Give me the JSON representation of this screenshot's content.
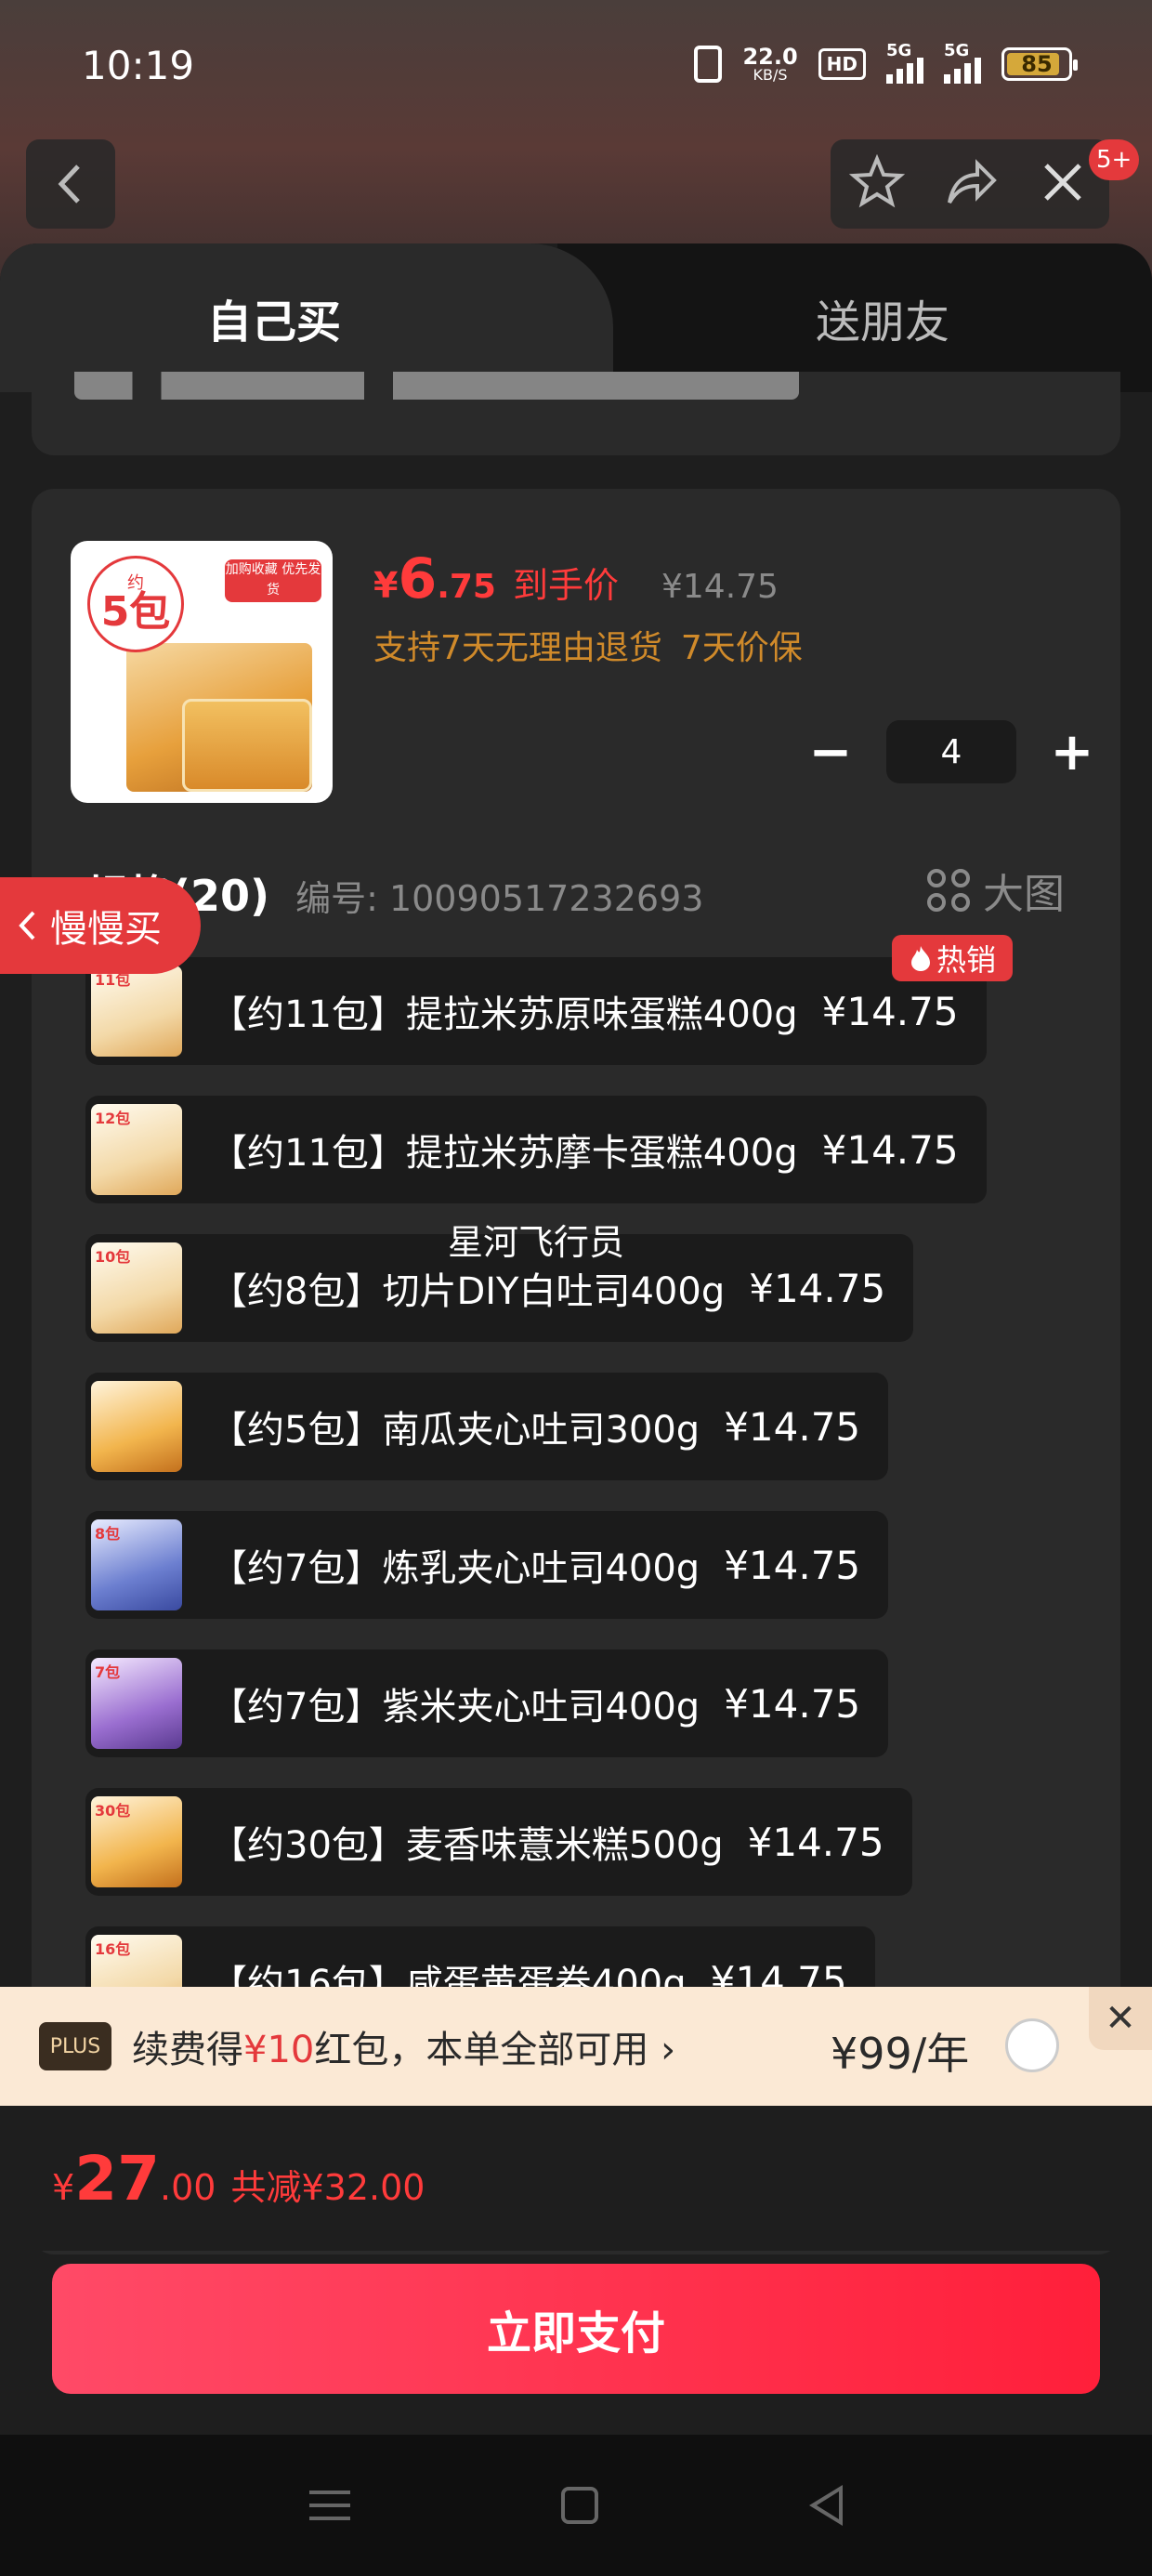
{
  "status_bar": {
    "time": "10:19",
    "net_speed": "22.0",
    "net_unit": "KB/S",
    "hd_label": "HD",
    "sim1_label": "5G",
    "sim2_label": "5G",
    "battery": "85"
  },
  "header": {
    "notification_badge": "5+"
  },
  "tabs": {
    "self": "自己买",
    "friend": "送朋友"
  },
  "product": {
    "image_circle_top": "约",
    "image_circle_main": "5包",
    "image_tag": "加购收藏 优先发货",
    "price_symbol": "¥",
    "price_int": "6",
    "price_dec": ".75",
    "price_label": "到手价",
    "original_price": "¥14.75",
    "guarantee_1": "支持7天无理由退货",
    "guarantee_2": "7天价保",
    "quantity": "4",
    "minus_symbol": "−",
    "plus_symbol": "+"
  },
  "spec": {
    "title": "规格(20)",
    "code_label": "编号: 10090517232693",
    "big_image": "大图",
    "hot_tag": "热销",
    "watermark": "星河飞行员",
    "items": [
      {
        "thumb_num": "11包",
        "label": "【约11包】提拉米苏原味蛋糕400g",
        "price": "¥14.75",
        "color": "white"
      },
      {
        "thumb_num": "12包",
        "label": "【约11包】提拉米苏摩卡蛋糕400g",
        "price": "¥14.75",
        "color": "white"
      },
      {
        "thumb_num": "10包",
        "label": "【约8包】切片DIY白吐司400g",
        "price": "¥14.75",
        "color": "white"
      },
      {
        "thumb_num": "",
        "label": "【约5包】南瓜夹心吐司300g",
        "price": "¥14.75",
        "color": "orange"
      },
      {
        "thumb_num": "8包",
        "label": "【约7包】炼乳夹心吐司400g",
        "price": "¥14.75",
        "color": "blue"
      },
      {
        "thumb_num": "7包",
        "label": "【约7包】紫米夹心吐司400g",
        "price": "¥14.75",
        "color": "purple"
      },
      {
        "thumb_num": "30包",
        "label": "【约30包】麦香味薏米糕500g",
        "price": "¥14.75",
        "color": "orange"
      },
      {
        "thumb_num": "16包",
        "label": "【约16包】咸蛋黄蛋卷400g",
        "price": "¥14.75",
        "color": "white"
      }
    ]
  },
  "slow_buy": {
    "label": "慢慢买"
  },
  "plus": {
    "badge": "PLUS",
    "text_prefix": "续费得",
    "text_red": "¥10",
    "text_suffix": "红包，本单全部可用",
    "arrow": "›",
    "price": "¥99/年",
    "close": "✕"
  },
  "total": {
    "symbol": "¥",
    "int": "27",
    "dec": ".00",
    "save": "共减¥32.00"
  },
  "pay_button": "立即支付"
}
